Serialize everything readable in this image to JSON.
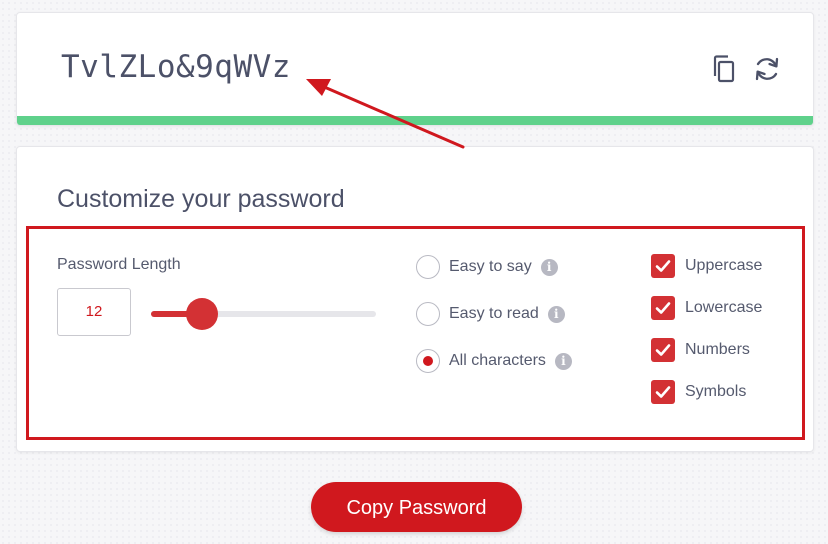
{
  "password": {
    "value": "TvlZLo&9qWVz",
    "strength_color": "#5fd18b"
  },
  "icons": {
    "copy": "copy-icon",
    "refresh": "refresh-icon",
    "info": "info-icon",
    "check": "check-icon"
  },
  "customize": {
    "title": "Customize your password",
    "length_label": "Password Length",
    "length_value": "12",
    "slider": {
      "min": 1,
      "max": 50,
      "value": 12
    },
    "char_modes": [
      {
        "label": "Easy to say",
        "checked": false
      },
      {
        "label": "Easy to read",
        "checked": false
      },
      {
        "label": "All characters",
        "checked": true
      }
    ],
    "options": [
      {
        "label": "Uppercase",
        "checked": true
      },
      {
        "label": "Lowercase",
        "checked": true
      },
      {
        "label": "Numbers",
        "checked": true
      },
      {
        "label": "Symbols",
        "checked": true
      }
    ]
  },
  "copy_button_label": "Copy Password",
  "colors": {
    "accent": "#d0181e",
    "text": "#555a6e",
    "annotation": "#d0181e"
  }
}
